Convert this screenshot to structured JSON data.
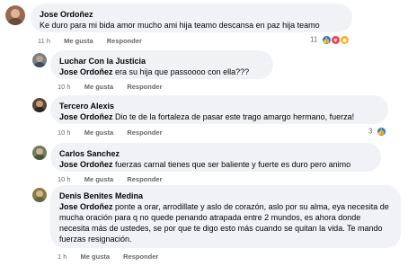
{
  "comments": [
    {
      "author": "Jose Ordoñez",
      "text": "Ke duro para mi bida amor mucho ami hija teamo descansa en paz hija teamo",
      "time": "11 h",
      "like": "Me gusta",
      "reply": "Responder",
      "reaction_count": "11",
      "reactions": [
        "like-icon",
        "love-icon",
        "sad-icon"
      ]
    },
    {
      "author": "Luchar Con la Justicia",
      "tag": "Jose Ordoñez",
      "text": "era su hija que passoooo con ella???",
      "time": "10 h",
      "like": "Me gusta",
      "reply": "Responder"
    },
    {
      "author": "Tercero Alexis",
      "tag": "Jose Ordoñez",
      "text": "Dio te de la fortaleza de pasar este trago amargo hermano, fuerza!",
      "time": "10 h",
      "like": "Me gusta",
      "reply": "Responder",
      "reaction_count": "3",
      "reactions": [
        "like-icon"
      ]
    },
    {
      "author": "Carlos Sanchez",
      "tag": "Jose Ordoñez",
      "text": "fuerzas carnal tienes que ser baliente y fuerte es duro pero animo",
      "time": "10 h",
      "like": "Me gusta",
      "reply": "Responder"
    },
    {
      "author": "Denis Benites Medina",
      "tag": "Jose Ordoñez",
      "text": "ponte a orar, arrodillate y aslo de corazón, aslo por su alma, eya necesita de mucha oración para q no quede penando atrapada entre 2 mundos, es ahora donde necesita más de ustedes, se por que te digo esto más cuando se quitan la vida. Te mando fuerzas resignación.",
      "time": "1 h",
      "like": "Me gusta",
      "reply": "Responder"
    }
  ],
  "colors": {
    "bubble": "#f0f2f5",
    "meta": "#65676b",
    "like": "#1877f2",
    "love": "#f33e58",
    "sad": "#f7b125"
  }
}
